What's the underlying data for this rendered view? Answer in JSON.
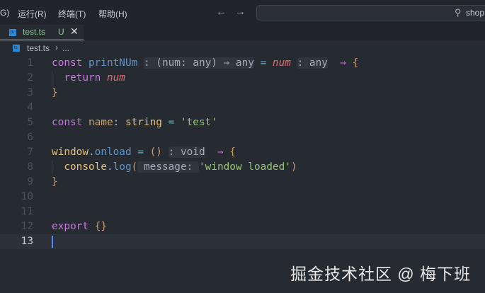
{
  "menu": [
    "G)",
    "运行(R)",
    "终端(T)",
    "帮助(H)"
  ],
  "nav": {
    "back": "←",
    "forward": "→"
  },
  "search": {
    "icon": "search-icon",
    "text": "shop"
  },
  "tab": {
    "name": "test.ts",
    "status": "U",
    "close": "✕"
  },
  "breadcrumb": {
    "file": "test.ts",
    "sep": "›",
    "more": "..."
  },
  "colors": {
    "keyword": "#c678dd",
    "func": "#5d93c8",
    "type": "#e5c07b",
    "param": "#e06c75",
    "brace": "#d19a66",
    "string": "#98c379",
    "op": "#56b6c2",
    "plain": "#abb2bf",
    "var": "#c9a26a"
  },
  "code": [
    {
      "n": "1",
      "tokens": [
        [
          "const ",
          "keyword"
        ],
        [
          "printNUm",
          "func"
        ],
        [
          " ",
          ""
        ],
        [
          ": (num: any) ⇒ any",
          "hint"
        ],
        [
          " = ",
          "op"
        ],
        [
          "num",
          "param-i"
        ],
        [
          " ",
          ""
        ],
        [
          ": any",
          "hint"
        ],
        [
          "  ⇒ ",
          "keyword"
        ],
        [
          "{",
          "brace"
        ]
      ]
    },
    {
      "n": "2",
      "guide": true,
      "tokens": [
        [
          "  return ",
          "keyword"
        ],
        [
          "num",
          "param-i"
        ]
      ]
    },
    {
      "n": "3",
      "tokens": [
        [
          "}",
          "brace"
        ]
      ]
    },
    {
      "n": "4",
      "tokens": []
    },
    {
      "n": "5",
      "tokens": [
        [
          "const ",
          "keyword"
        ],
        [
          "name",
          "var"
        ],
        [
          ": ",
          "plain"
        ],
        [
          "string",
          "type"
        ],
        [
          " = ",
          "op"
        ],
        [
          "'test'",
          "string"
        ]
      ]
    },
    {
      "n": "6",
      "tokens": []
    },
    {
      "n": "7",
      "tokens": [
        [
          "window",
          "type"
        ],
        [
          ".",
          "plain"
        ],
        [
          "onload",
          "func"
        ],
        [
          " = ",
          "op"
        ],
        [
          "()",
          "brace"
        ],
        [
          " ",
          ""
        ],
        [
          ": void",
          "hint"
        ],
        [
          "  ⇒ ",
          "keyword"
        ],
        [
          "{",
          "brace"
        ]
      ]
    },
    {
      "n": "8",
      "guide": true,
      "tokens": [
        [
          "  console",
          "type"
        ],
        [
          ".",
          "plain"
        ],
        [
          "log",
          "func"
        ],
        [
          "(",
          "brace"
        ],
        [
          " message: ",
          "hint"
        ],
        [
          "'window loaded'",
          "string"
        ],
        [
          ")",
          "brace"
        ]
      ]
    },
    {
      "n": "9",
      "tokens": [
        [
          "}",
          "brace"
        ]
      ]
    },
    {
      "n": "10",
      "tokens": []
    },
    {
      "n": "11",
      "tokens": []
    },
    {
      "n": "12",
      "tokens": [
        [
          "export ",
          "keyword"
        ],
        [
          "{}",
          "brace"
        ]
      ]
    },
    {
      "n": "13",
      "current": true,
      "tokens": []
    }
  ],
  "watermark": "掘金技术社区 @ 梅下班"
}
